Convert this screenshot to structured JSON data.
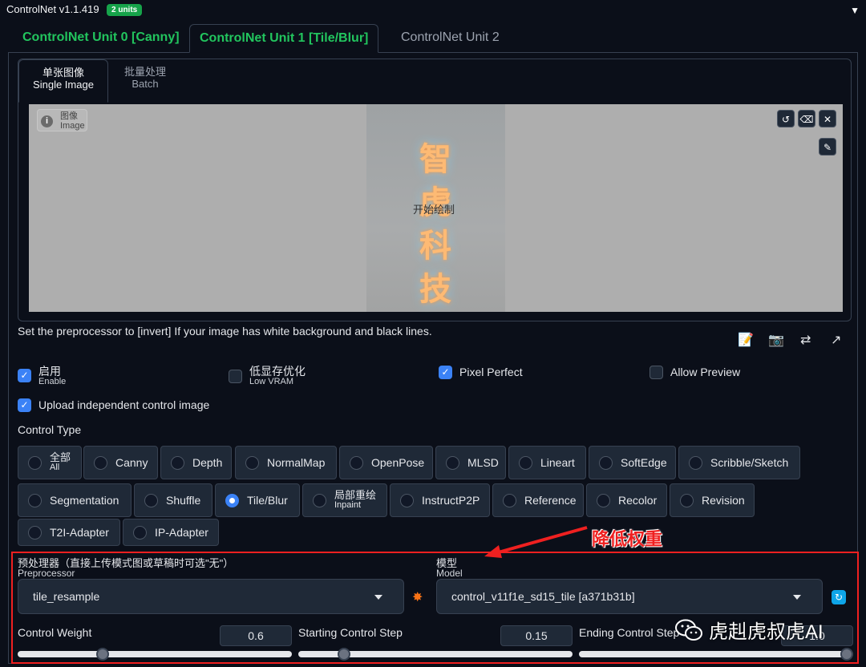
{
  "header": {
    "title": "ControlNet v1.1.419",
    "badge": "2 units",
    "collapse_glyph": "▼"
  },
  "unit_tabs": [
    {
      "label": "ControlNet Unit 0 [Canny]"
    },
    {
      "label": "ControlNet Unit 1 [Tile/Blur]"
    },
    {
      "label": "ControlNet Unit 2"
    }
  ],
  "image_tabs": [
    {
      "label_zh": "单张图像",
      "label_en": "Single Image"
    },
    {
      "label_zh": "批量处理",
      "label_en": "Batch"
    }
  ],
  "canvas": {
    "label_zh": "图像",
    "label_en": "Image",
    "start_text": "开始绘制",
    "image_chars": [
      "智",
      "虎",
      "科",
      "技"
    ]
  },
  "hint": "Set the preprocessor to [invert] If your image has white background and black lines.",
  "checkboxes": {
    "enable": {
      "zh": "启用",
      "en": "Enable",
      "checked": true
    },
    "low_vram": {
      "zh": "低显存优化",
      "en": "Low VRAM",
      "checked": false
    },
    "pixel_perfect": {
      "label": "Pixel Perfect",
      "checked": true
    },
    "allow_preview": {
      "label": "Allow Preview",
      "checked": false
    },
    "upload_independent": {
      "label": "Upload independent control image",
      "checked": true
    }
  },
  "control_type": {
    "label": "Control Type",
    "options": [
      {
        "zh": "全部",
        "en": "All"
      },
      {
        "label": "Canny"
      },
      {
        "label": "Depth"
      },
      {
        "label": "NormalMap"
      },
      {
        "label": "OpenPose"
      },
      {
        "label": "MLSD"
      },
      {
        "label": "Lineart"
      },
      {
        "label": "SoftEdge"
      },
      {
        "label": "Scribble/Sketch"
      },
      {
        "label": "Segmentation"
      },
      {
        "label": "Shuffle"
      },
      {
        "label": "Tile/Blur",
        "selected": true
      },
      {
        "zh": "局部重绘",
        "en": "Inpaint"
      },
      {
        "label": "InstructP2P"
      },
      {
        "label": "Reference"
      },
      {
        "label": "Recolor"
      },
      {
        "label": "Revision"
      },
      {
        "label": "T2I-Adapter"
      },
      {
        "label": "IP-Adapter"
      }
    ]
  },
  "annotation": "降低权重",
  "preprocessor": {
    "label_zh": "预处理器（直接上传模式图或草稿时可选\"无\"）",
    "label_en": "Preprocessor",
    "value": "tile_resample"
  },
  "model": {
    "label_zh": "模型",
    "label_en": "Model",
    "value": "control_v11f1e_sd15_tile [a371b31b]"
  },
  "sliders": {
    "control_weight": {
      "label": "Control Weight",
      "value": "0.6",
      "fraction": 0.3
    },
    "starting_step": {
      "label": "Starting Control Step",
      "value": "0.15",
      "fraction": 0.15
    },
    "ending_step": {
      "label": "Ending Control Step",
      "value": "1.0",
      "fraction": 1.0
    }
  },
  "watermark": "虎赳虎叔虎AI"
}
